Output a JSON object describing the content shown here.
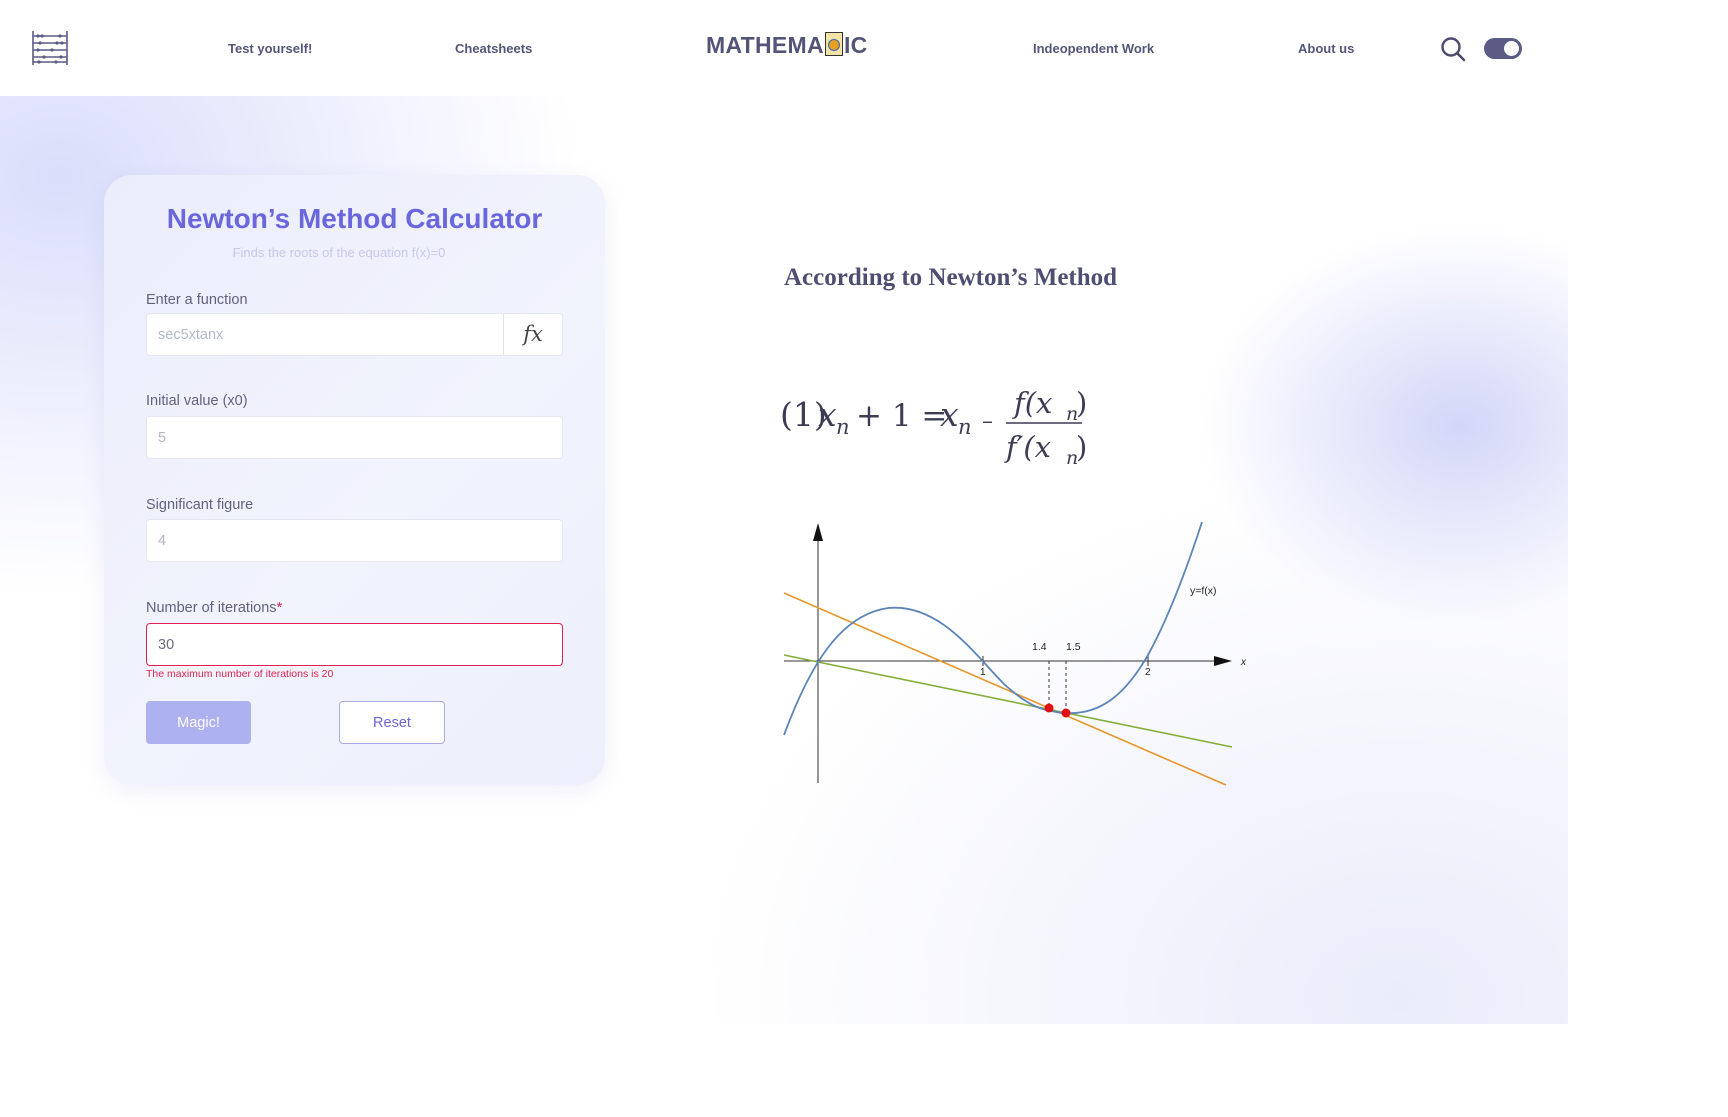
{
  "header": {
    "logo_text_left": "MATHEMA",
    "logo_text_right": "IC",
    "nav": [
      {
        "label": "Test yourself!"
      },
      {
        "label": "Cheatsheets"
      },
      {
        "label": "Indeopendent Work"
      },
      {
        "label": "About us"
      }
    ],
    "theme_toggle_on": true
  },
  "calculator": {
    "title": "Newton’s Method Calculator",
    "subtitle": "Finds the roots of the equation f(x)=0",
    "function": {
      "label": "Enter a function",
      "placeholder": "sec5xtanx",
      "fx_button": "𝑓𝑥"
    },
    "initial": {
      "label": "Initial value (x0)",
      "placeholder": "5"
    },
    "sigfig": {
      "label": "Significant figure",
      "placeholder": "4"
    },
    "iterations": {
      "label": "Number of iterations",
      "required_mark": "*",
      "value": "30",
      "error": "The maximum number of iterations is 20"
    },
    "magic_button": "Magic!",
    "reset_button": "Reset"
  },
  "method": {
    "heading": "According to  Newton’s Method",
    "formula": {
      "prefix": "(1)",
      "lhs_var": "x",
      "lhs_sub": "n",
      "plus_one": "+ 1 =",
      "rhs_var": "x",
      "rhs_sub": "n",
      "minus": "–",
      "numerator": "f(x",
      "denominator": "f′(x",
      "sub": "n",
      "close": ")"
    }
  },
  "graph": {
    "curve_label": "y=f(x)",
    "x_axis_label": "x",
    "tick_1": "1",
    "tick_2": "2",
    "tick_14": "1.4",
    "tick_15": "1.5",
    "colors": {
      "curve": "#5b84b8",
      "tangent_orange": "#e8962a",
      "tangent_green": "#86ad3a",
      "points": "#e01010"
    }
  }
}
